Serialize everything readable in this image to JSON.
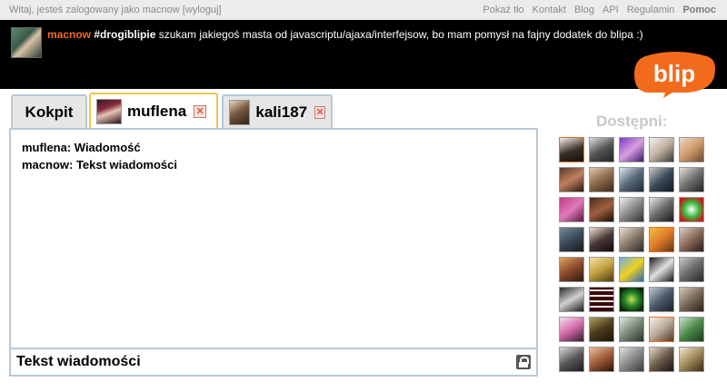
{
  "topbar": {
    "welcome": "Witaj, jesteś zalogowany jako macnow",
    "logout": "[wyloguj]",
    "links": [
      "Pokaż tło",
      "Kontakt",
      "Blog",
      "API",
      "Regulamin",
      "Pomoc"
    ]
  },
  "status": {
    "user": "macnow",
    "tag": "#drogiblipie",
    "text": " szukam jakiegoś masta od javascriptu/ajaxa/interfejsow, bo mam pomysł na fajny dodatek do blipa :)"
  },
  "logo": {
    "text": "blip",
    "color": "#f26b1d"
  },
  "tabs": [
    {
      "label": "Kokpit"
    },
    {
      "label": "muflena"
    },
    {
      "label": "kali187"
    }
  ],
  "messages": [
    "muflena: Wiadomość",
    "macnow: Tekst wiadomości"
  ],
  "composer": {
    "value": "Tekst wiadomości"
  },
  "online": {
    "title": "Dostępni:"
  },
  "colors": {
    "accent": "#f26b1d",
    "tab_border": "#b9c7d6",
    "active_tab_border": "#f1c64d"
  }
}
